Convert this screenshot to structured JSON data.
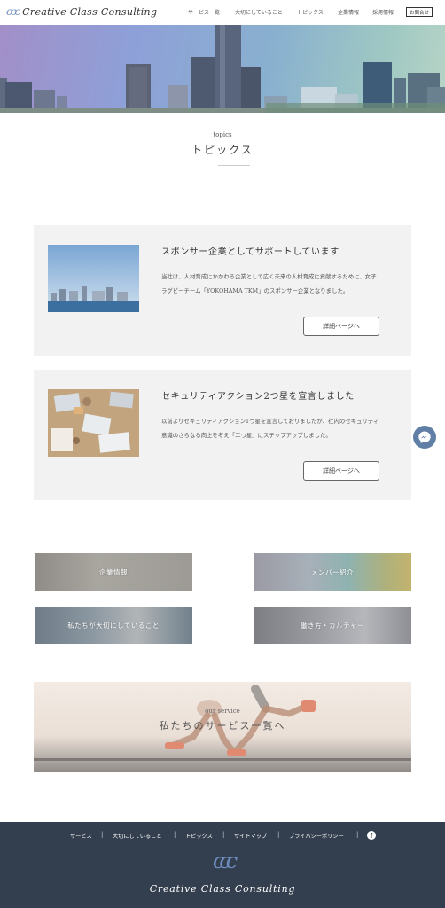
{
  "header": {
    "logo_mark": "ccc",
    "logo_text": "Creative Class Consulting",
    "nav": [
      "サービス一覧",
      "大切にしていること",
      "トピックス",
      "企業情報",
      "採用情報"
    ],
    "contact_label": "お問合せ"
  },
  "topics": {
    "subtitle": "topics",
    "title": "トピックス"
  },
  "cards": [
    {
      "title": "スポンサー企業としてサポートしています",
      "body": "当社は、人材育成にかかわる企業として広く未来の人材育成に貢献するために、女子ラグビーチーム「YOKOHAMA TKM」のスポンサー企業となりました。",
      "button": "詳細ページへ"
    },
    {
      "title": "セキュリティアクション2つ星を宣言しました",
      "body": "以前よりセキュリティアクション1つ星を宣言しておりましたが、社内のセキュリティ意識のさらなる向上を考え「二つ星」にステップアップしました。",
      "button": "詳細ページへ"
    }
  ],
  "tiles": [
    {
      "label": "企業情報"
    },
    {
      "label": "メンバー紹介"
    },
    {
      "label": "私たちが大切にしていること"
    },
    {
      "label": "働き方・カルチャー"
    }
  ],
  "service": {
    "subtitle": "our service",
    "title": "私たちのサービス一覧へ"
  },
  "footer": {
    "nav": [
      "サービス",
      "大切にしていること",
      "トピックス",
      "サイトマップ",
      "プライバシーポリシー"
    ],
    "separator": "|",
    "facebook_glyph": "f",
    "logo_mark": "ccc",
    "logo_text": "Creative Class Consulting"
  },
  "colors": {
    "accent": "#6f8ec0",
    "footer_bg": "#333e4e",
    "card_bg": "#f2f2f2",
    "messenger": "#5f7fa6"
  },
  "icons": {
    "messenger": "messenger-icon",
    "facebook": "facebook-icon"
  }
}
